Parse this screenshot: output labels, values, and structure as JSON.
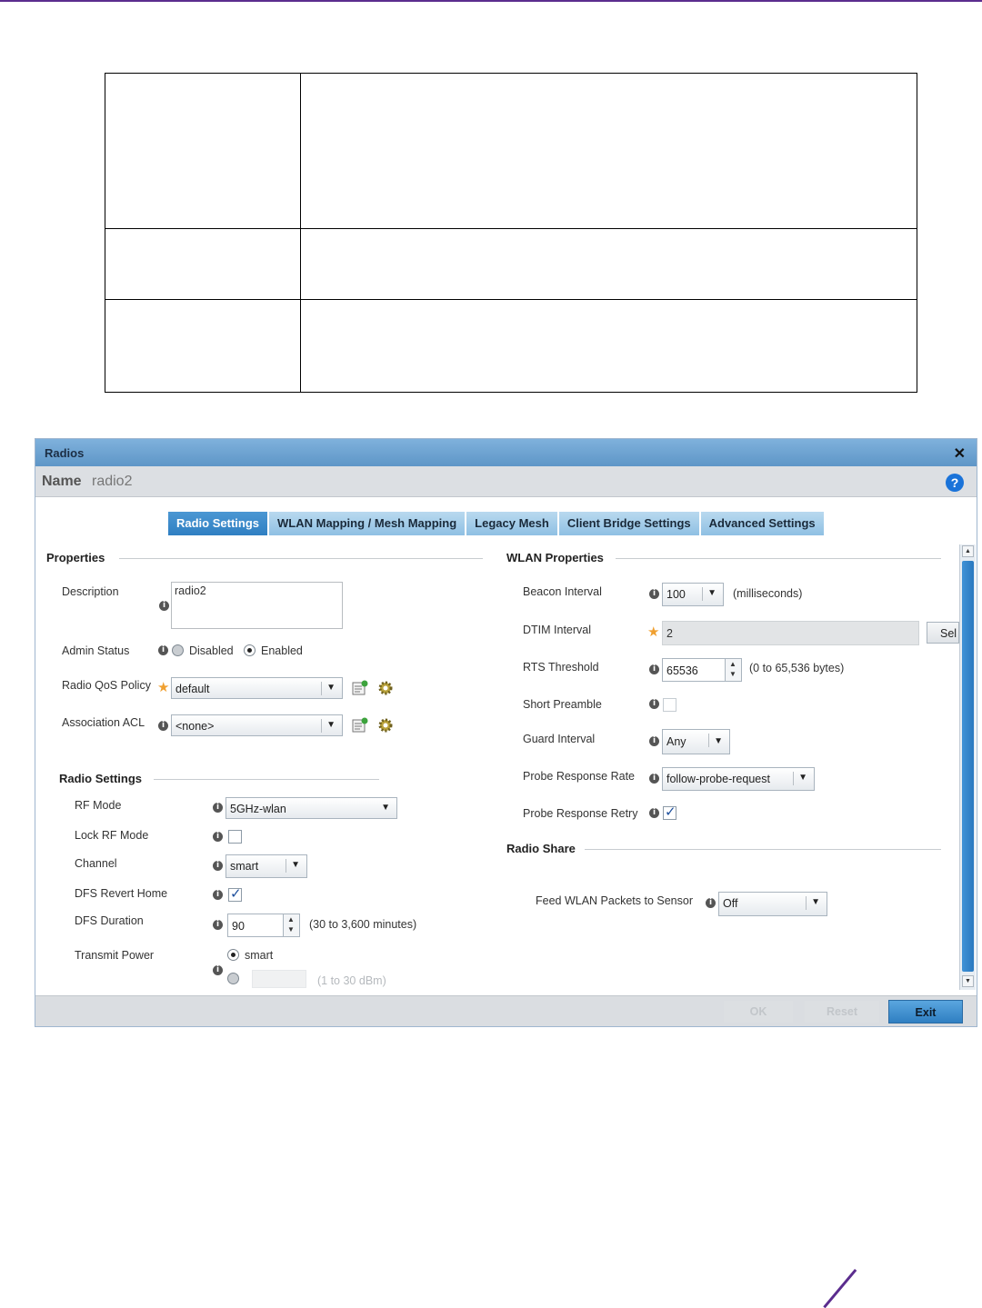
{
  "dialog": {
    "title": "Radios",
    "close_icon": "close-icon",
    "name_label": "Name",
    "name_value": "radio2",
    "help_glyph": "?"
  },
  "tabs": [
    {
      "label": "Radio Settings",
      "active": true
    },
    {
      "label": "WLAN Mapping / Mesh Mapping",
      "active": false
    },
    {
      "label": "Legacy Mesh",
      "active": false
    },
    {
      "label": "Client Bridge Settings",
      "active": false
    },
    {
      "label": "Advanced Settings",
      "active": false
    }
  ],
  "properties": {
    "heading": "Properties",
    "description_label": "Description",
    "description_value": "radio2",
    "admin_status_label": "Admin Status",
    "admin_disabled": "Disabled",
    "admin_enabled": "Enabled",
    "admin_selected": "Enabled",
    "qos_label": "Radio QoS Policy",
    "qos_value": "default",
    "acl_label": "Association ACL",
    "acl_value": "<none>"
  },
  "radio_settings": {
    "heading": "Radio Settings",
    "rf_mode_label": "RF Mode",
    "rf_mode_value": "5GHz-wlan",
    "lock_rf_label": "Lock RF Mode",
    "lock_rf_checked": false,
    "channel_label": "Channel",
    "channel_value": "smart",
    "dfs_revert_label": "DFS Revert Home",
    "dfs_revert_checked": true,
    "dfs_duration_label": "DFS Duration",
    "dfs_duration_value": "90",
    "dfs_duration_range": "(30 to 3,600 minutes)",
    "tx_power_label": "Transmit Power",
    "tx_power_smart": "smart",
    "tx_power_range": "(1 to 30 dBm)"
  },
  "wlan_properties": {
    "heading": "WLAN Properties",
    "beacon_label": "Beacon Interval",
    "beacon_value": "100",
    "beacon_unit": "(milliseconds)",
    "dtim_label": "DTIM Interval",
    "dtim_value": "2",
    "dtim_button": "Sel",
    "rts_label": "RTS Threshold",
    "rts_value": "65536",
    "rts_range": "(0 to 65,536 bytes)",
    "short_preamble_label": "Short Preamble",
    "short_preamble_checked": false,
    "guard_label": "Guard Interval",
    "guard_value": "Any",
    "probe_rate_label": "Probe Response Rate",
    "probe_rate_value": "follow-probe-request",
    "probe_retry_label": "Probe Response Retry",
    "probe_retry_checked": true
  },
  "radio_share": {
    "heading": "Radio Share",
    "feed_label": "Feed WLAN Packets to Sensor",
    "feed_value": "Off"
  },
  "footer": {
    "ok_label": "OK",
    "reset_label": "Reset",
    "exit_label": "Exit"
  },
  "colors": {
    "accent": "#5b2d8e",
    "titlebar": "#6aa3d2",
    "active_tab": "#3a89c9",
    "exit_button": "#2f7fc2"
  }
}
